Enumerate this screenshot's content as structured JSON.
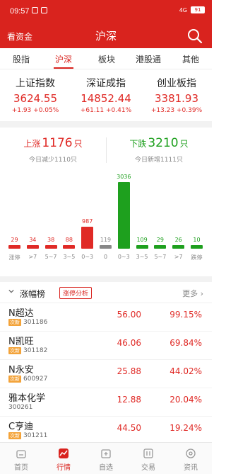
{
  "status": {
    "time": "09:57",
    "battery": "91",
    "network": "4G"
  },
  "header": {
    "left_link": "看资金",
    "title": "沪深"
  },
  "tabs": [
    "股指",
    "沪深",
    "板块",
    "港股通",
    "其他"
  ],
  "indices": [
    {
      "name": "上证指数",
      "value": "3624.55",
      "change": "+1.93",
      "pct": "+0.05%"
    },
    {
      "name": "深证成指",
      "value": "14852.44",
      "change": "+61.11",
      "pct": "+0.41%"
    },
    {
      "name": "创业板指",
      "value": "3381.93",
      "change": "+13.23",
      "pct": "+0.39%"
    }
  ],
  "updown": {
    "up_label": "上涨",
    "up_count": "1176",
    "unit": "只",
    "up_sub": "今日减少1110只",
    "down_label": "下跌",
    "down_count": "3210",
    "down_sub": "今日新增1111只"
  },
  "chart_data": {
    "type": "bar",
    "categories": [
      "涨停",
      ">7",
      "5~7",
      "3~5",
      "0~3",
      "0",
      "0~3",
      "3~5",
      "5~7",
      ">7",
      "跌停"
    ],
    "values": [
      29,
      34,
      38,
      88,
      987,
      119,
      3036,
      109,
      29,
      26,
      10
    ],
    "colors": [
      "#e02a26",
      "#e02a26",
      "#e02a26",
      "#e02a26",
      "#e02a26",
      "#888888",
      "#1ea01e",
      "#1ea01e",
      "#1ea01e",
      "#1ea01e",
      "#1ea01e"
    ]
  },
  "rank": {
    "title": "涨幅榜",
    "analysis": "涨停分析",
    "more": "更多"
  },
  "rows": [
    {
      "name": "N超达",
      "tag": "次新",
      "code": "301186",
      "price": "56.00",
      "pct": "99.15%"
    },
    {
      "name": "N凯旺",
      "tag": "次新",
      "code": "301182",
      "price": "46.06",
      "pct": "69.84%"
    },
    {
      "name": "N永安",
      "tag": "次新",
      "code": "600927",
      "price": "25.88",
      "pct": "44.02%"
    },
    {
      "name": "雅本化学",
      "tag": "",
      "code": "300261",
      "price": "12.88",
      "pct": "20.04%"
    },
    {
      "name": "C亨迪",
      "tag": "次新",
      "code": "301211",
      "price": "44.50",
      "pct": "19.24%"
    }
  ],
  "nav": [
    "首页",
    "行情",
    "自选",
    "交易",
    "资讯"
  ],
  "colors": {
    "brand": "#d9231e",
    "up": "#e02a26",
    "down": "#1ea01e",
    "flat": "#888888"
  }
}
